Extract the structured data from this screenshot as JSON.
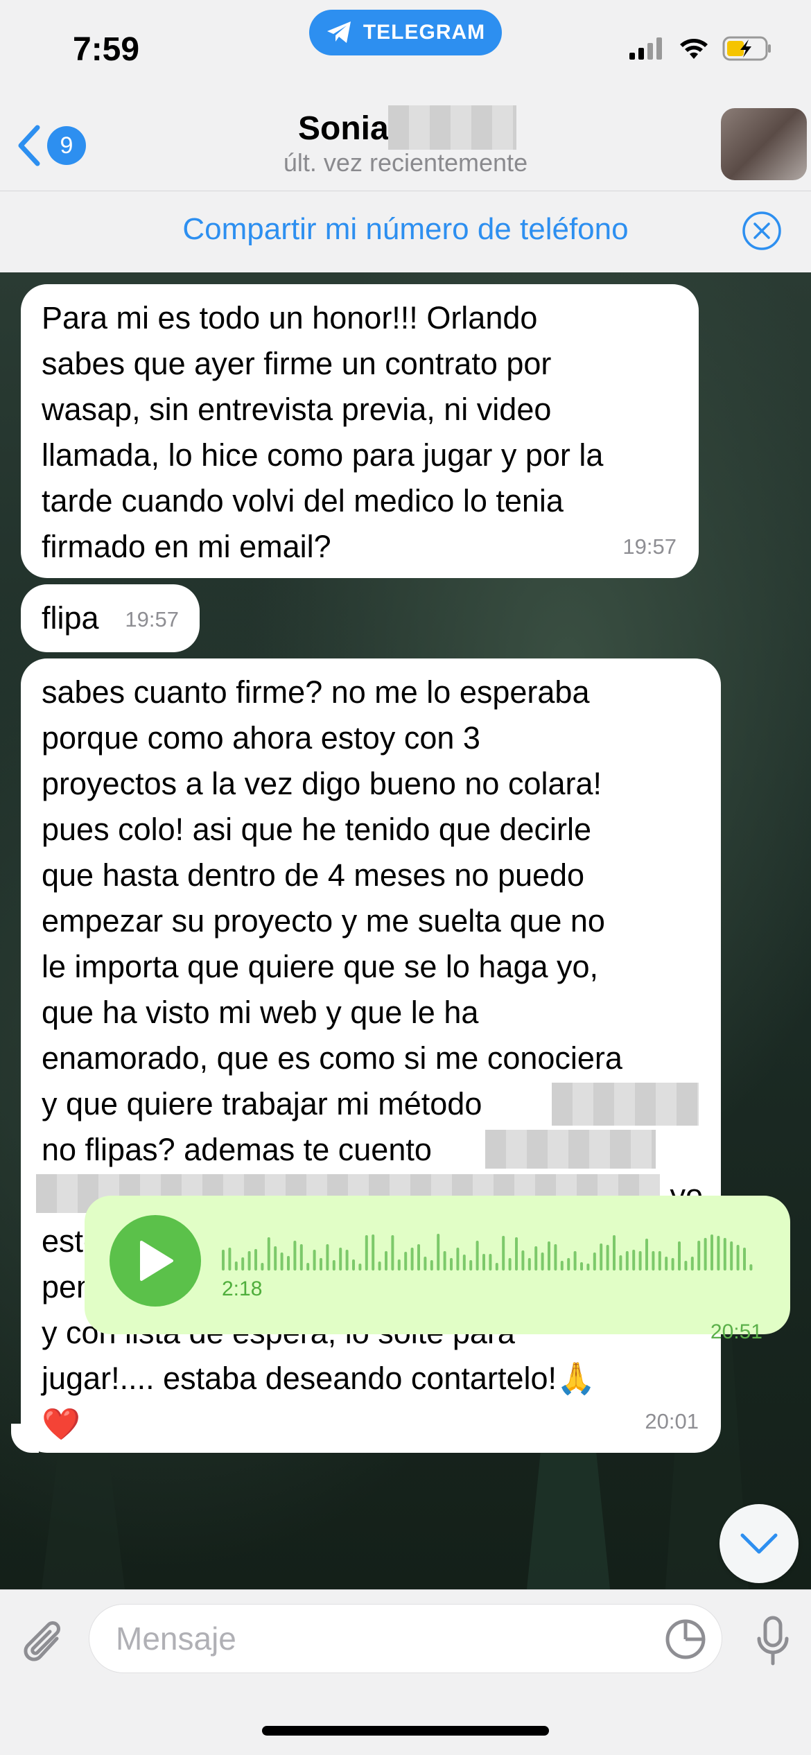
{
  "status_bar": {
    "time": "7:59",
    "app_pill": "TELEGRAM"
  },
  "header": {
    "back_count": "9",
    "contact_name": "Sonia",
    "contact_status": "últ. vez recientemente"
  },
  "banner": {
    "share_text": "Compartir mi número de teléfono"
  },
  "messages": [
    {
      "text": "Para mi es todo un honor!!! Orlando\nsabes que ayer firme un contrato por\nwasap, sin entrevista previa, ni video\nllamada, lo hice como para jugar y por la\ntarde cuando volvi del medico lo tenia\nfirmado en mi email?",
      "time": "19:57"
    },
    {
      "text": "flipa",
      "time": "19:57"
    },
    {
      "text_part1": "sabes cuanto firme? no me lo esperaba\nporque como ahora estoy con 3\nproyectos a la vez digo bueno no colara!\npues colo! asi que he tenido que decirle\nque hasta dentro de 4 meses no puedo\nempezar su proyecto y me suelta que no\nle importa que quiere que se lo haga yo,\nque ha visto mi web y que le ha\nenamorado, que es como si me conociera\ny que quiere trabajar mi método",
      "text_part2": "no flipas? ademas te cuento",
      "text_part3": "yo",
      "text_part4": "estoy flipando Orlando sabes que nunca\npense que me iba a aceptar esa cantidad\ny con lista de espera, lo solte para\njugar!.... estaba deseando contartelo!🙏\n❤️",
      "time": "20:01"
    }
  ],
  "voice_message": {
    "duration": "2:18",
    "time": "20:51"
  },
  "input": {
    "placeholder": "Mensaje"
  },
  "colors": {
    "accent": "#2d8ff0",
    "voice_bubble": "#e1fec6",
    "play_button": "#5bc14a"
  }
}
